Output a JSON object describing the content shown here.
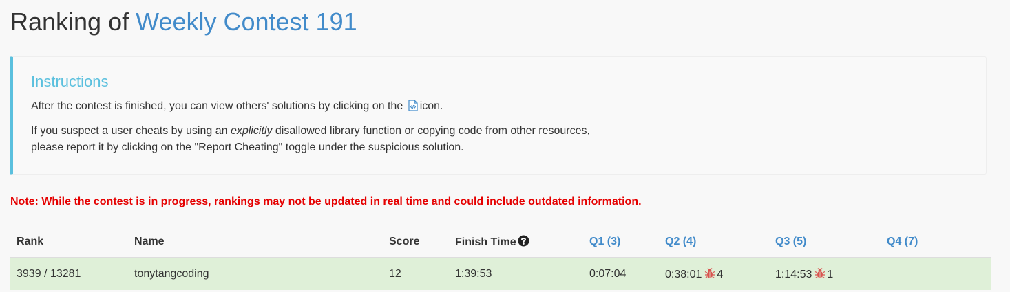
{
  "header": {
    "title_prefix": "Ranking of ",
    "contest_name": "Weekly Contest 191"
  },
  "instructions": {
    "heading": "Instructions",
    "line1_before_icon": "After the contest is finished, you can view others' solutions by clicking on the",
    "line1_after_icon": "icon.",
    "line2_part1": "If you suspect a user cheats by using an ",
    "line2_emph": "explicitly",
    "line2_part2": " disallowed library function or copying code from other resources,",
    "line3": "please report it by clicking on the \"Report Cheating\" toggle under the suspicious solution."
  },
  "note": "Note: While the contest is in progress, rankings may not be updated in real time and could include outdated information.",
  "table": {
    "headers": {
      "rank": "Rank",
      "name": "Name",
      "score": "Score",
      "finish_time": "Finish Time",
      "q1": "Q1 (3)",
      "q2": "Q2 (4)",
      "q3": "Q3 (5)",
      "q4": "Q4 (7)"
    },
    "rows": [
      {
        "rank": "3939 / 13281",
        "name": "tonytangcoding",
        "score": "12",
        "finish_time": "1:39:53",
        "q1": "0:07:04",
        "q2_time": "0:38:01",
        "q2_penalty": "4",
        "q3_time": "1:14:53",
        "q3_penalty": "1",
        "q4": ""
      }
    ]
  },
  "colors": {
    "link": "#428bca",
    "instructions_accent": "#5bc0de",
    "note": "#e50000",
    "row_success": "#dff0d8",
    "bug": "#d9534f"
  },
  "icons": {
    "code": "code-file-icon",
    "help": "question-circle-icon",
    "bug": "bug-icon"
  }
}
